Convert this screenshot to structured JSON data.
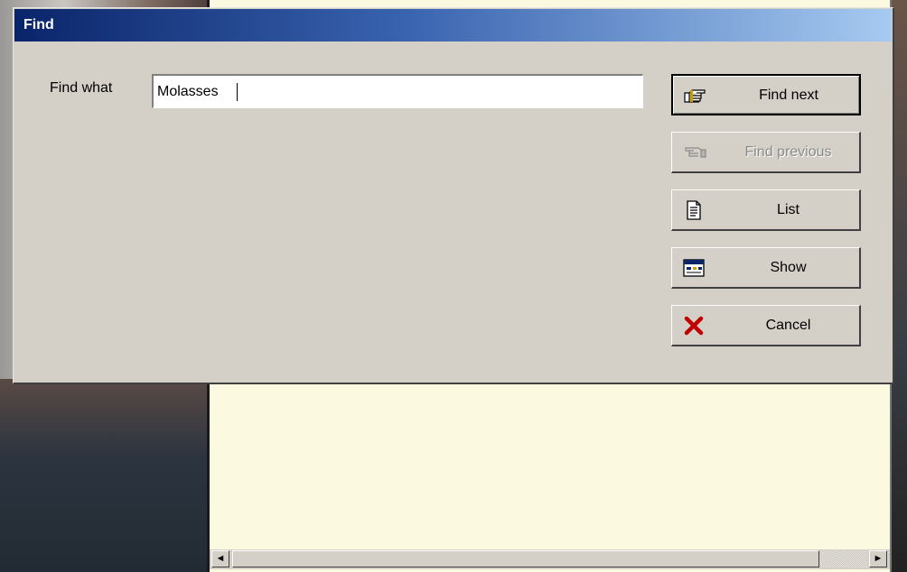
{
  "dialog": {
    "title": "Find",
    "find_label": "Find what",
    "find_value": "Molasses"
  },
  "buttons": {
    "find_next": "Find next",
    "find_previous": "Find previous",
    "list": "List",
    "show": "Show",
    "cancel": "Cancel"
  },
  "scrollbar": {
    "left_arrow": "◄",
    "right_arrow": "►"
  },
  "icons": {
    "find_next": "pointing-hand-right-icon",
    "find_previous": "pointing-hand-left-icon",
    "list": "document-icon",
    "show": "window-preview-icon",
    "cancel": "red-x-icon"
  },
  "colors": {
    "dialog_bg": "#d4d0c8",
    "titlebar_start": "#0a246a",
    "titlebar_end": "#a6caf0",
    "document_bg": "#fbfae1",
    "cancel_x": "#c00000"
  }
}
